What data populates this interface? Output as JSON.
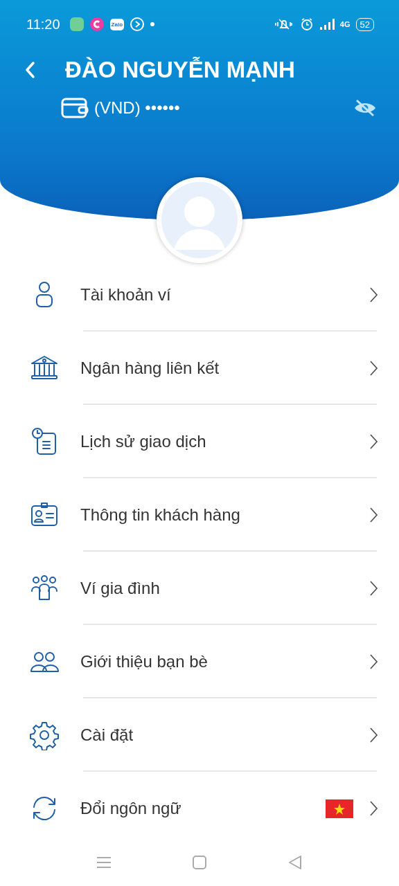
{
  "status_bar": {
    "time": "11:20",
    "app_icons": [
      {
        "kind": "chat"
      },
      {
        "kind": "c"
      },
      {
        "kind": "zalo",
        "label": "Zalo"
      },
      {
        "kind": "play"
      }
    ],
    "network": "4G",
    "battery": "52"
  },
  "header": {
    "title": "ĐÀO NGUYỄN MẠNH",
    "balance": "(VND) ••••••",
    "balance_hidden": true
  },
  "menu": [
    {
      "kind": "user",
      "label": "Tài khoản ví"
    },
    {
      "kind": "bank",
      "label": "Ngân hàng liên kết"
    },
    {
      "kind": "history",
      "label": "Lịch sử giao dịch"
    },
    {
      "kind": "idcard",
      "label": "Thông tin khách hàng"
    },
    {
      "kind": "family",
      "label": "Ví gia đình"
    },
    {
      "kind": "friends",
      "label": "Giới thiệu bạn bè"
    },
    {
      "kind": "settings",
      "label": "Cài đặt"
    },
    {
      "kind": "language",
      "label": "Đổi ngôn ngữ",
      "flag": true
    }
  ]
}
